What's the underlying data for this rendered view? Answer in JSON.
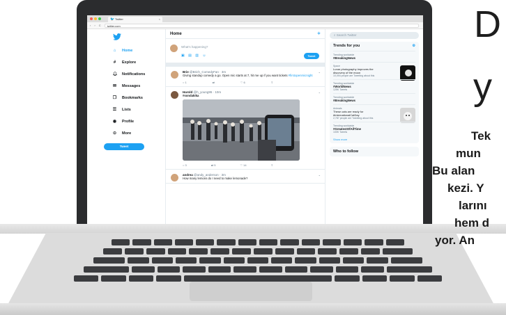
{
  "browser": {
    "tab_title": "Twitter",
    "tab_close": "×",
    "nav_back": "‹",
    "nav_forward": "›",
    "nav_reload": "C",
    "url": "twitter.com"
  },
  "sidebar": {
    "items": [
      {
        "label": "Home",
        "icon": "home-icon",
        "glyph": "⌂"
      },
      {
        "label": "Explore",
        "icon": "hashtag-icon",
        "glyph": "#"
      },
      {
        "label": "Notifications",
        "icon": "bell-icon",
        "glyph": "♫"
      },
      {
        "label": "Messages",
        "icon": "mail-icon",
        "glyph": "✉"
      },
      {
        "label": "Bookmarks",
        "icon": "bookmark-icon",
        "glyph": "❐"
      },
      {
        "label": "Lists",
        "icon": "list-icon",
        "glyph": "☰"
      },
      {
        "label": "Profile",
        "icon": "profile-icon",
        "glyph": "◉"
      },
      {
        "label": "More",
        "icon": "more-icon",
        "glyph": "⊙"
      }
    ],
    "tweet_button": "Tweet"
  },
  "timeline": {
    "title": "Home",
    "compose_placeholder": "What's happening?",
    "compose_tools": "▣ ▤ ▥ ☺",
    "compose_button": "Tweet",
    "tweets": [
      {
        "name": "Brie",
        "handle": "@Brich_ComedyFan · 3m",
        "text": "Giving standup comedy a go. Open mic starts at 7, hit me up if you want tickets",
        "tag": "#firstopenmicnight",
        "replies": "1",
        "retweets": "",
        "likes": "6"
      },
      {
        "name": "Harold",
        "handle": "@h_young95 · 10m",
        "text": "",
        "tag": "#sondakika",
        "replies": "3",
        "retweets": "5",
        "likes": "14"
      },
      {
        "name": "andrea",
        "handle": "@andy_anderson · 3m",
        "text": "How many lemons do I need to make lemonade?",
        "tag": ""
      }
    ]
  },
  "right_column": {
    "search_placeholder": "Search Twitter",
    "trends_title": "Trends for you",
    "trends": [
      {
        "meta": "Trending worldwide",
        "name": "#BreakingNews",
        "desc": "",
        "count": ""
      },
      {
        "meta": "Space",
        "name": "",
        "desc": "Lunar photography improves the discovery of the moon",
        "count": "10,094 people are Tweeting about this"
      },
      {
        "meta": "Trending worldwide",
        "name": "#WorldNews",
        "desc": "",
        "count": "125K Tweets"
      },
      {
        "meta": "Trending worldwide",
        "name": "#BreakingNews",
        "desc": "",
        "count": ""
      },
      {
        "meta": "Animals",
        "name": "",
        "desc": "These cats are ready for #InternationalCatDay",
        "count": "2,787 people are Tweeting about this"
      },
      {
        "meta": "Trending worldwide",
        "name": "#GreatestOfAllTime",
        "desc": "",
        "count": "100K Tweets"
      }
    ],
    "show_more": "Show more",
    "who_to_follow": "Who to follow"
  },
  "article": {
    "drop_letter_1": "D",
    "drop_letter_2": "y",
    "lines": [
      "Tek",
      "mun",
      "Bu alan",
      "kezi. Y",
      "larını",
      "hem d",
      "yor. An"
    ]
  },
  "colors": {
    "twitter_blue": "#1da1f2",
    "laptop_body": "#2b2c2e",
    "key": "#3b3c3f",
    "silver": "#dcdcdc"
  }
}
